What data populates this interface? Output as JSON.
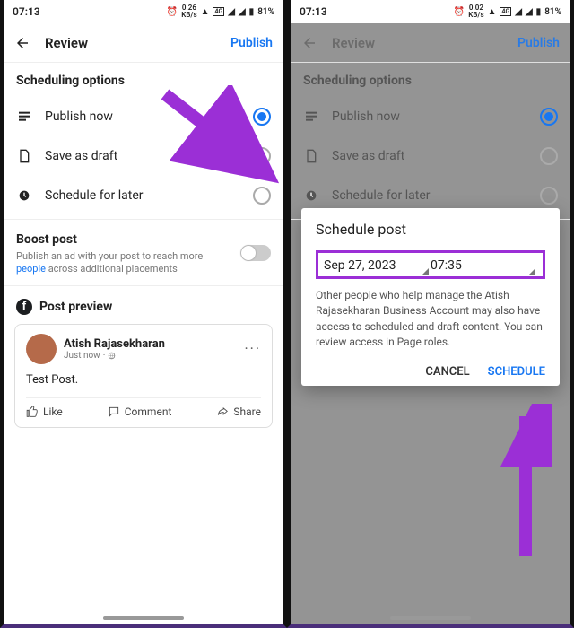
{
  "status": {
    "time": "07:13",
    "kbps": "0.26",
    "kbps_unit": "KB/s",
    "battery": "81%"
  },
  "header": {
    "title": "Review",
    "publish": "Publish"
  },
  "scheduling": {
    "title": "Scheduling options",
    "options": [
      {
        "label": "Publish now",
        "icon": "feed"
      },
      {
        "label": "Save as draft",
        "icon": "draft"
      },
      {
        "label": "Schedule for later",
        "icon": "clock"
      }
    ]
  },
  "boost": {
    "title": "Boost post",
    "desc_pre": "Publish an ad with your post to reach more ",
    "desc_link": "people",
    "desc_post": " across additional placements"
  },
  "preview": {
    "title": "Post preview",
    "author": "Atish Rajasekharan",
    "timestamp": "Just now",
    "body": "Test Post.",
    "like": "Like",
    "comment": "Comment",
    "share": "Share"
  },
  "dialog": {
    "title": "Schedule post",
    "date": "Sep 27, 2023",
    "time": "07:35",
    "message": "Other people who help manage the Atish Rajasekharan Business Account may also have access to scheduled and draft content. You can review access in Page roles.",
    "cancel": "CANCEL",
    "schedule": "SCHEDULE"
  },
  "status2": {
    "kbps": "0.02"
  }
}
